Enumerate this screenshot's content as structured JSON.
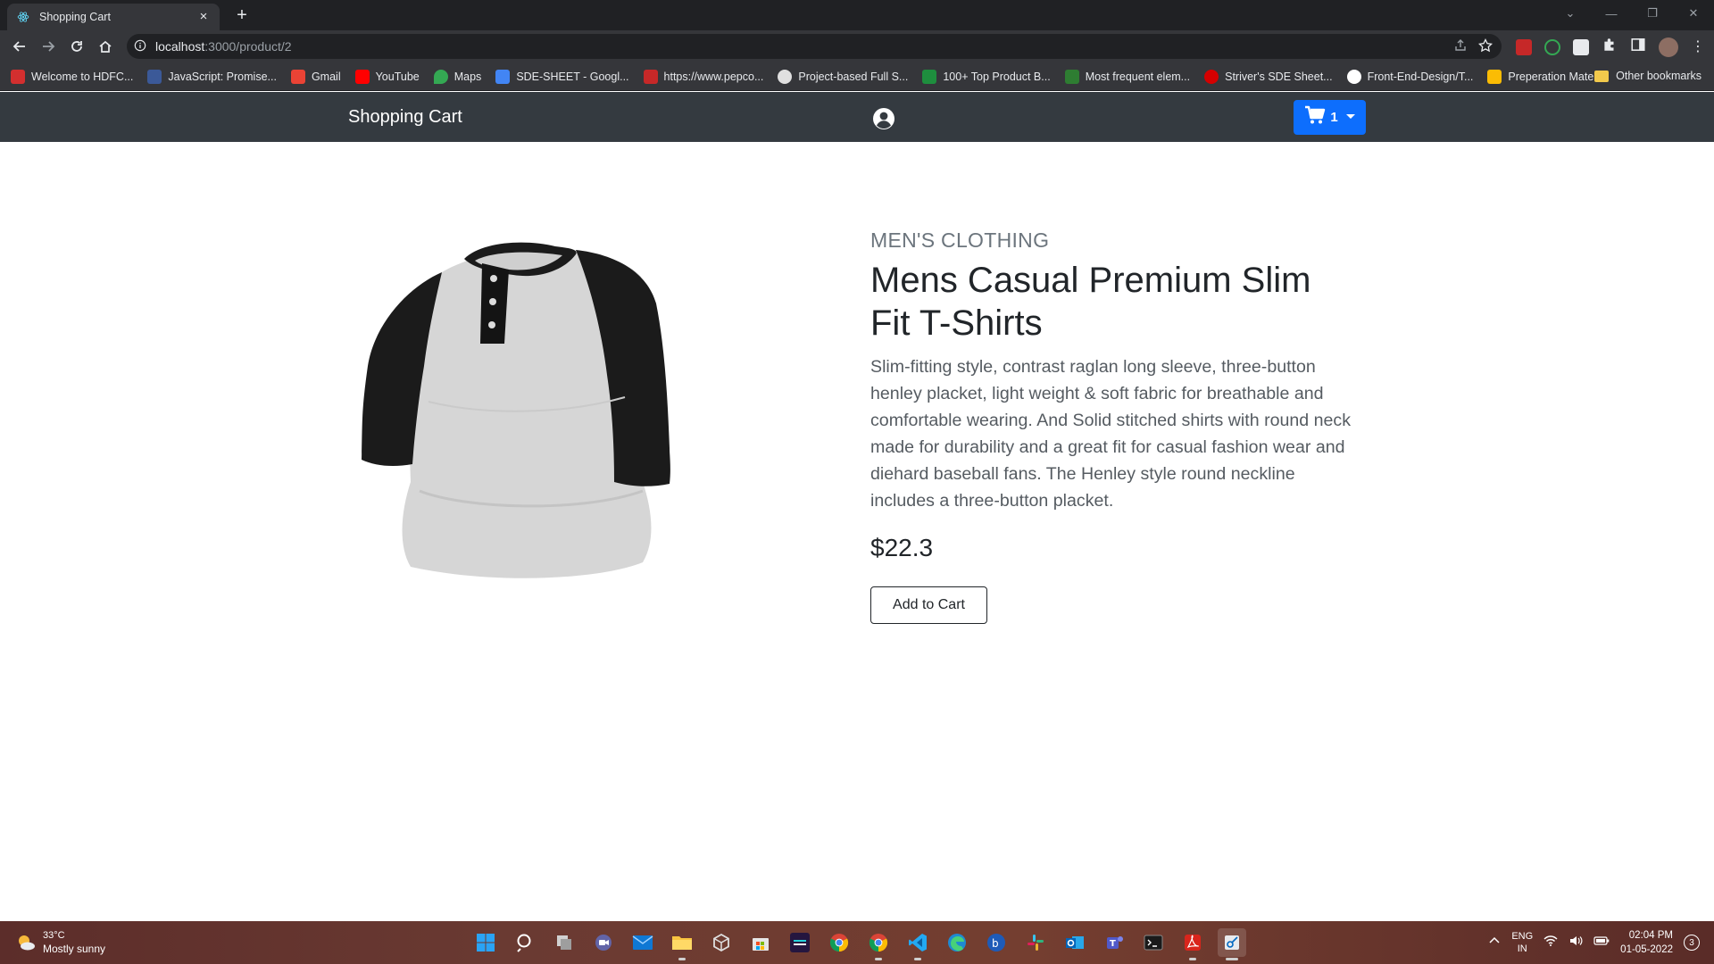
{
  "browser": {
    "tab_title": "Shopping Cart",
    "new_tab_label": "+",
    "url_host": "localhost",
    "url_path": ":3000/product/2",
    "bookmarks": [
      {
        "label": "Welcome to HDFC...",
        "color": "#d32f2f"
      },
      {
        "label": "JavaScript: Promise...",
        "color": "#3b5998"
      },
      {
        "label": "Gmail",
        "color": "#ea4335"
      },
      {
        "label": "YouTube",
        "color": "#ff0000"
      },
      {
        "label": "Maps",
        "color": "#34a853"
      },
      {
        "label": "SDE-SHEET - Googl...",
        "color": "#4285f4"
      },
      {
        "label": "https://www.pepco...",
        "color": "#c62828"
      },
      {
        "label": "Project-based Full S...",
        "color": "#e0e0e0"
      },
      {
        "label": "100+ Top Product B...",
        "color": "#1e8e3e"
      },
      {
        "label": "Most frequent elem...",
        "color": "#2e7d32"
      },
      {
        "label": "Striver's SDE Sheet...",
        "color": "#d50000"
      },
      {
        "label": "Front-End-Design/T...",
        "color": "#ffffff"
      },
      {
        "label": "Preperation Materi...",
        "color": "#fbbc04"
      }
    ],
    "other_bookmarks": "Other bookmarks"
  },
  "navbar": {
    "brand": "Shopping Cart",
    "cart_count": "1",
    "cart_color": "#0d6efd"
  },
  "product": {
    "category": "MEN'S CLOTHING",
    "title": "Mens Casual Premium Slim Fit T-Shirts",
    "description": "Slim-fitting style, contrast raglan long sleeve, three-button henley placket, light weight & soft fabric for breathable and comfortable wearing. And Solid stitched shirts with round neck made for durability and a great fit for casual fashion wear and diehard baseball fans. The Henley style round neckline includes a three-button placket.",
    "price": "$22.3",
    "add_button": "Add to Cart"
  },
  "taskbar": {
    "temperature": "33°C",
    "weather": "Mostly sunny",
    "lang_top": "ENG",
    "lang_bottom": "IN",
    "time": "02:04 PM",
    "date": "01-05-2022",
    "notifications": "3"
  }
}
